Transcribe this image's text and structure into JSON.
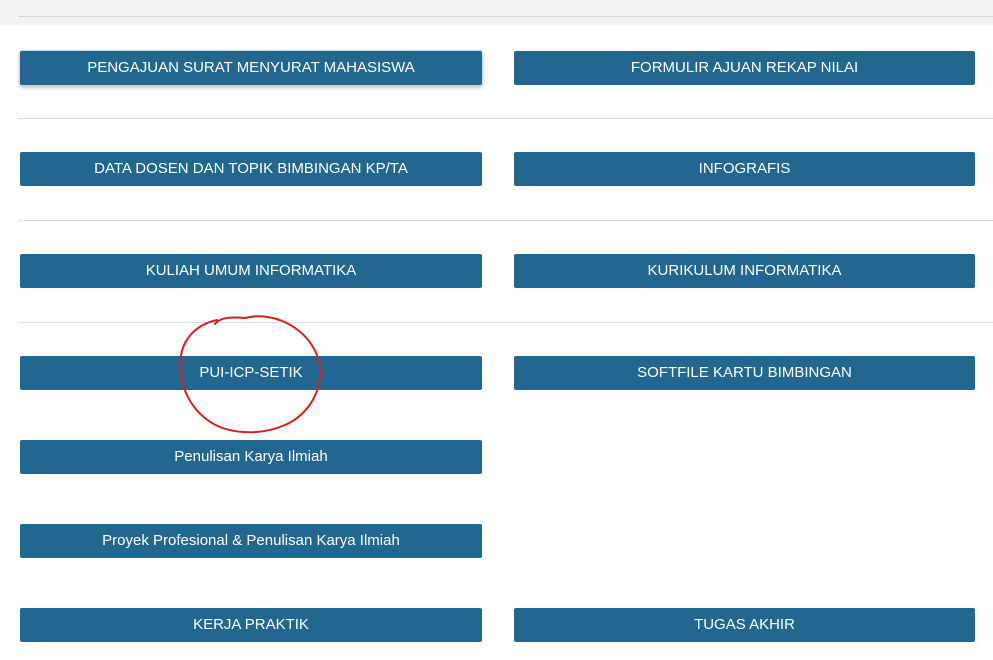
{
  "buttons": {
    "pengajuan_surat": "PENGAJUAN SURAT MENYURAT MAHASISWA",
    "formulir_rekap": "FORMULIR AJUAN REKAP NILAI",
    "data_dosen": "DATA DOSEN DAN TOPIK BIMBINGAN KP/TA",
    "infografis": "INFOGRAFIS",
    "kuliah_umum": "KULIAH UMUM INFORMATIKA",
    "kurikulum": "KURIKULUM INFORMATIKA",
    "pui_icp": "PUI-ICP-SETIK",
    "softfile_kartu": "SOFTFILE KARTU BIMBINGAN",
    "penulisan_karya": "Penulisan Karya Ilmiah",
    "proyek_profesional": "Proyek Profesional & Penulisan Karya Ilmiah",
    "kerja_praktik": "KERJA PRAKTIK",
    "tugas_akhir": "TUGAS AKHIR"
  },
  "colors": {
    "button_bg": "#21678f",
    "button_text": "#ffffff",
    "annotation": "#d42020",
    "divider": "#dcdcdc"
  }
}
